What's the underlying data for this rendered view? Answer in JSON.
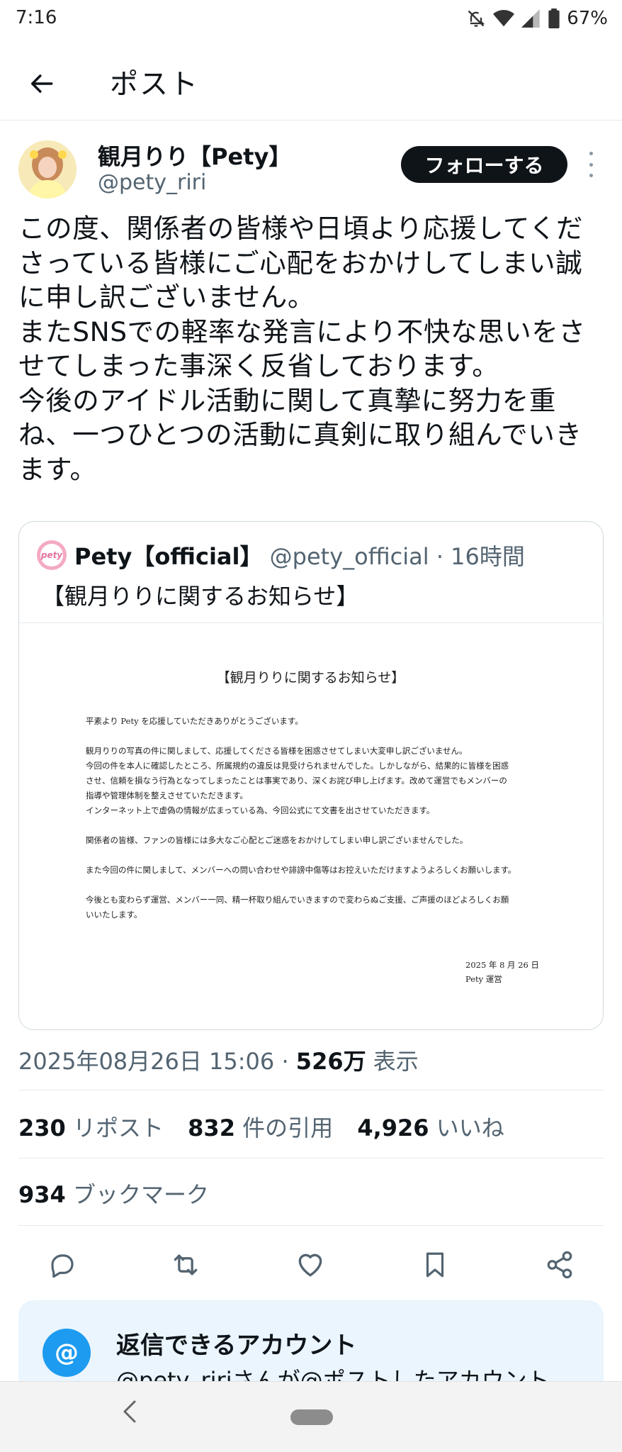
{
  "status_bar": {
    "time": "7:16",
    "battery": "67%",
    "icons": [
      "bell-off-icon",
      "wifi-icon",
      "signal-icon",
      "battery-icon"
    ]
  },
  "header": {
    "title": "ポスト",
    "back_icon": "arrow-left-icon"
  },
  "post": {
    "author_name": "観月りり【Pety】",
    "author_handle": "@pety_riri",
    "follow_label": "フォローする",
    "text": "この度、関係者の皆様や日頃より応援してくださっている皆様にご心配をおかけしてしまい誠に申し訳ございません。\nまたSNSでの軽率な発言により不快な思いをさせてしまった事深く反省しております。\n今後のアイドル活動に関して真摯に努力を重ね、一つひとつの活動に真剣に取り組んでいきます。",
    "time": "2025年08月26日 15:06",
    "separator": "·",
    "views_count": "526万",
    "views_label": "表示"
  },
  "quote": {
    "name": "Pety【official】",
    "handle": "@pety_official",
    "separator": "·",
    "time": "16時間",
    "avatar_text": "pety",
    "text": "【観月りりに関するお知らせ】",
    "image": {
      "title": "【観月りりに関するお知らせ】",
      "lines": [
        "平素より Pety を応援していただきありがとうございます。",
        "",
        "観月りりの写真の件に関しまして、応援してくださる皆様を困惑させてしまい大変申し訳ございません。",
        "今回の件を本人に確認したところ、所属規約の違反は見受けられませんでした。しかしながら、結果的に皆様を困惑",
        "させ、信頼を損なう行為となってしまったことは事実であり、深くお詫び申し上げます。改めて運営でもメンバーの",
        "指導や管理体制を整えさせていただきます。",
        "インターネット上で虚偽の情報が広まっている為、今回公式にて文書を出させていただきます。",
        "",
        "関係者の皆様、ファンの皆様には多大なご心配とご迷惑をおかけしてしまい申し訳ございませんでした。",
        "",
        "また今回の件に関しまして、メンバーへの問い合わせや誹謗中傷等はお控えいただけますようよろしくお願いします。",
        "",
        "今後とも変わらず運営、メンバー一同、精一杯取り組んでいきますので変わらぬご支援、ご声援のほどよろしくお願",
        "いいたします。"
      ],
      "date": "2025 年 8 月 26 日",
      "signature": "Pety 運営"
    }
  },
  "stats": {
    "reposts_count": "230",
    "reposts_label": "リポスト",
    "quotes_count": "832",
    "quotes_label": "件の引用",
    "likes_count": "4,926",
    "likes_label": "いいね",
    "bookmarks_count": "934",
    "bookmarks_label": "ブックマーク"
  },
  "actions": [
    "reply-icon",
    "repost-icon",
    "like-icon",
    "bookmark-icon",
    "share-icon"
  ],
  "reply_banner": {
    "icon": "@",
    "title": "返信できるアカウント",
    "description": "@pety_ririさんが@ポストしたアカウント"
  },
  "colors": {
    "accent": "#1d9bf0",
    "text_primary": "#0f1419",
    "text_secondary": "#536471",
    "banner_bg": "#eaf5fd",
    "follow_bg": "#0f1419"
  }
}
